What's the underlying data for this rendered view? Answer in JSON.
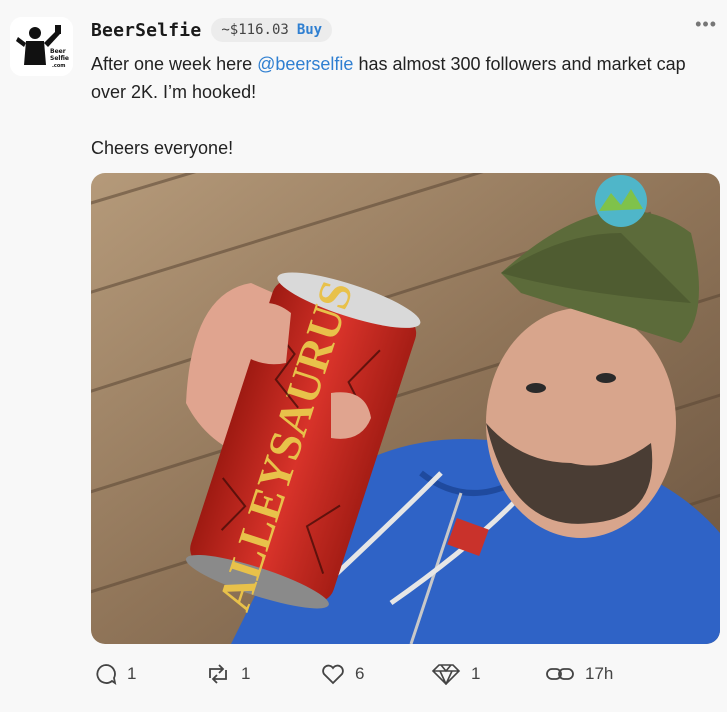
{
  "post": {
    "author": "BeerSelfie",
    "price": "~$116.03",
    "buy_label": "Buy",
    "more_label": "•••",
    "text_line1_before": "After one week here ",
    "mention": "@beerselfie",
    "text_line1_after": " has almost 300 followers and market cap over 2K. I’m hooked!",
    "text_line2": "Cheers everyone!",
    "avatar_text": "Beer Selfie .com",
    "image_alt": "Man in blue hoodie and green cap holding a red ALLEYSAURUS beer can"
  },
  "actions": {
    "replies": "1",
    "reposts": "1",
    "likes": "6",
    "diamonds": "1",
    "time": "17h"
  },
  "colors": {
    "accent": "#2f7fd1",
    "background": "#f8f8f8"
  },
  "icons": [
    "comment-icon",
    "repost-icon",
    "heart-icon",
    "diamond-icon",
    "link-icon"
  ]
}
